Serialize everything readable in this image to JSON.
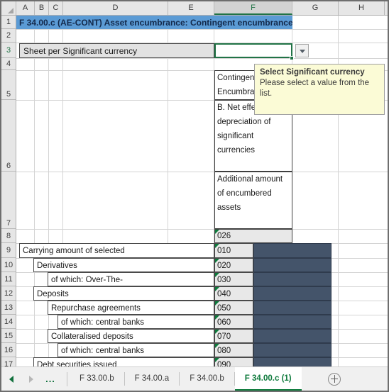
{
  "columns": [
    {
      "label": "A",
      "active": false
    },
    {
      "label": "B",
      "active": false
    },
    {
      "label": "C",
      "active": false
    },
    {
      "label": "D",
      "active": false
    },
    {
      "label": "E",
      "active": false
    },
    {
      "label": "F",
      "active": true
    },
    {
      "label": "G",
      "active": false
    },
    {
      "label": "H",
      "active": false
    }
  ],
  "rows": [
    {
      "label": "1",
      "active": false
    },
    {
      "label": "2",
      "active": false
    },
    {
      "label": "3",
      "active": true
    },
    {
      "label": "4",
      "active": false
    },
    {
      "label": "5",
      "active": false
    },
    {
      "label": "6",
      "active": false
    },
    {
      "label": "7",
      "active": false
    },
    {
      "label": "8",
      "active": false
    },
    {
      "label": "9",
      "active": false
    },
    {
      "label": "10",
      "active": false
    },
    {
      "label": "11",
      "active": false
    },
    {
      "label": "12",
      "active": false
    },
    {
      "label": "13",
      "active": false
    },
    {
      "label": "14",
      "active": false
    },
    {
      "label": "15",
      "active": false
    },
    {
      "label": "16",
      "active": false
    },
    {
      "label": "17",
      "active": false
    }
  ],
  "title": "F 34.00.c (AE-CONT) Asset encumbrance: Contingent encumbrance",
  "currency_label": "Sheet per Significant currency",
  "currency_value": "",
  "column_f_headers": {
    "group": "Contingent Encumbrance",
    "scenario": "B. Net effect of 10% depreciation of significant currencies",
    "measure": "Additional amount of encumbered assets",
    "code": "026"
  },
  "table": {
    "rows": [
      {
        "label": "Carrying amount of selected",
        "code": "010",
        "indent": 0
      },
      {
        "label": "Derivatives",
        "code": "020",
        "indent": 1
      },
      {
        "label": "of which: Over-The-",
        "code": "030",
        "indent": 2
      },
      {
        "label": "Deposits",
        "code": "040",
        "indent": 1
      },
      {
        "label": "Repurchase agreements",
        "code": "050",
        "indent": 2
      },
      {
        "label": "of which: central banks",
        "code": "060",
        "indent": 3
      },
      {
        "label": "Collateralised deposits",
        "code": "070",
        "indent": 2
      },
      {
        "label": "of which: central banks",
        "code": "080",
        "indent": 3
      },
      {
        "label": "Debt securities issued",
        "code": "090",
        "indent": 1
      }
    ]
  },
  "tooltip": {
    "title": "Select Significant currency",
    "body": "Please select a value from the list."
  },
  "tabs": {
    "ellipsis": "...",
    "items": [
      {
        "label": "F 33.00.b",
        "active": false
      },
      {
        "label": "F 34.00.a",
        "active": false
      },
      {
        "label": "F 34.00.b",
        "active": false
      },
      {
        "label": "F 34.00.c (1)",
        "active": true
      }
    ]
  },
  "colors": {
    "title_fill": "#5B9BD5",
    "blocked_fill": "#44546A",
    "accent_green": "#217346",
    "tooltip_fill": "#FBFBD6"
  }
}
